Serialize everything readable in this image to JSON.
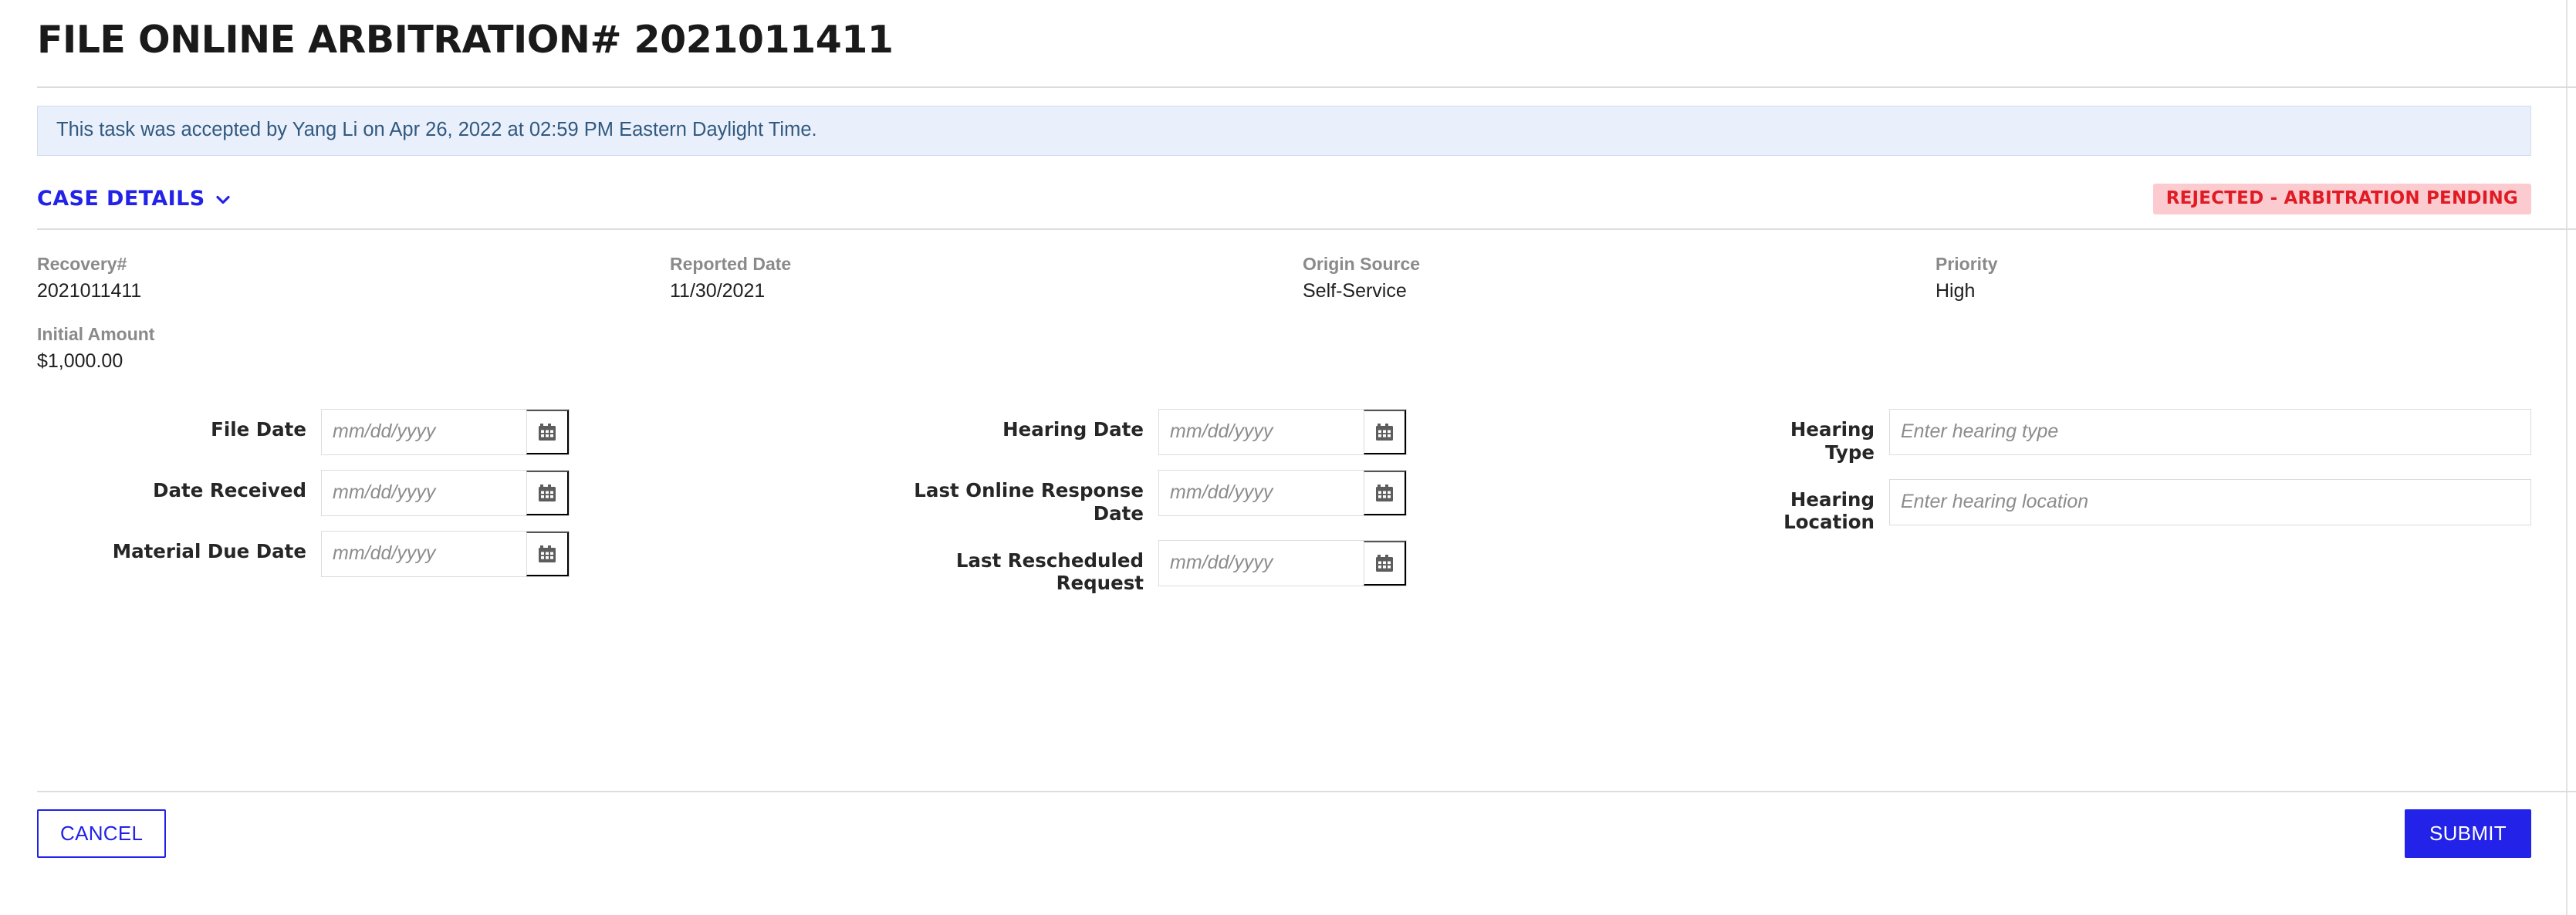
{
  "header": {
    "title": "FILE ONLINE ARBITRATION# 2021011411"
  },
  "alert": {
    "message": "This task was accepted by Yang Li on Apr 26, 2022 at 02:59 PM  Eastern Daylight Time."
  },
  "section": {
    "title": "CASE DETAILS",
    "chevron_icon": "chevron-down-icon",
    "status_badge": "REJECTED - ARBITRATION PENDING",
    "badge_bg_color": "#fbcbd0",
    "badge_text_color": "#e01b24",
    "accent_color": "#2222e8"
  },
  "details": [
    {
      "label": "Recovery#",
      "value": "2021011411"
    },
    {
      "label": "Reported Date",
      "value": "11/30/2021"
    },
    {
      "label": "Origin Source",
      "value": "Self-Service"
    },
    {
      "label": "Priority",
      "value": "High"
    },
    {
      "label": "Initial Amount",
      "value": "$1,000.00"
    }
  ],
  "form": {
    "column_1": [
      {
        "label": "File Date",
        "placeholder": "mm/dd/yyyy",
        "value": "",
        "icon": "calendar-icon"
      },
      {
        "label": "Date Received",
        "placeholder": "mm/dd/yyyy",
        "value": "",
        "icon": "calendar-icon"
      },
      {
        "label": "Material Due Date",
        "placeholder": "mm/dd/yyyy",
        "value": "",
        "icon": "calendar-icon"
      }
    ],
    "column_2": [
      {
        "label": "Hearing Date",
        "placeholder": "mm/dd/yyyy",
        "value": "",
        "icon": "calendar-icon"
      },
      {
        "label": "Last Online Response Date",
        "placeholder": "mm/dd/yyyy",
        "value": "",
        "icon": "calendar-icon"
      },
      {
        "label": "Last Rescheduled Request",
        "placeholder": "mm/dd/yyyy",
        "value": "",
        "icon": "calendar-icon"
      }
    ],
    "column_3": [
      {
        "label": "Hearing Type",
        "placeholder": "Enter hearing type",
        "value": ""
      },
      {
        "label": "Hearing Location",
        "placeholder": "Enter hearing location",
        "value": ""
      }
    ]
  },
  "footer": {
    "cancel_label": "CANCEL",
    "submit_label": "SUBMIT"
  }
}
